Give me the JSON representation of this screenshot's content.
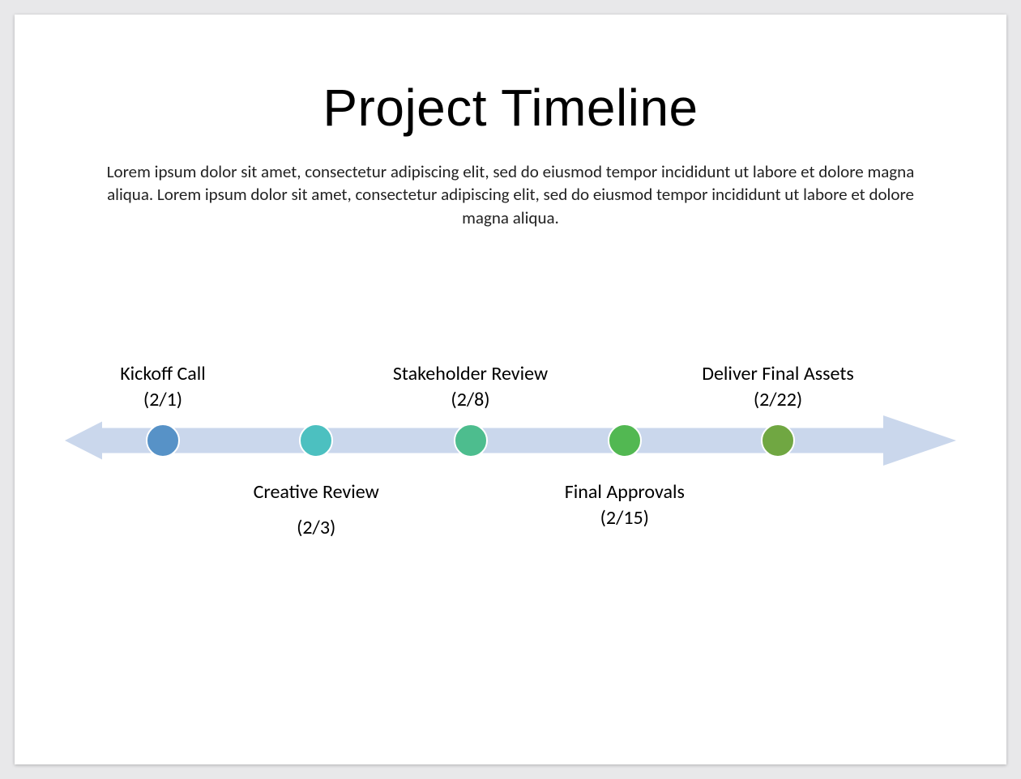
{
  "title": "Project Timeline",
  "description": "Lorem ipsum dolor sit amet, consectetur adipiscing elit, sed do eiusmod tempor incididunt ut labore et dolore magna aliqua. Lorem ipsum dolor sit amet, consectetur adipiscing elit, sed do eiusmod tempor incididunt ut labore et dolore magna aliqua.",
  "arrow_color": "#cad7ec",
  "milestones": [
    {
      "label": "Kickoff Call",
      "date": "(2/1)",
      "position": "above",
      "x_pct": 11,
      "dot_color": "#5792c7",
      "date_spaced": false
    },
    {
      "label": "Creative Review",
      "date": "(2/3)",
      "position": "below",
      "x_pct": 28.2,
      "dot_color": "#4cc0c0",
      "date_spaced": true
    },
    {
      "label": "Stakeholder Review",
      "date": "(2/8)",
      "position": "above",
      "x_pct": 45.5,
      "dot_color": "#4dbd8e",
      "date_spaced": false
    },
    {
      "label": "Final Approvals",
      "date": "(2/15)",
      "position": "below",
      "x_pct": 62.8,
      "dot_color": "#52b852",
      "date_spaced": false
    },
    {
      "label": "Deliver Final Assets",
      "date": "(2/22)",
      "position": "above",
      "x_pct": 80,
      "dot_color": "#70a742",
      "date_spaced": false
    }
  ]
}
